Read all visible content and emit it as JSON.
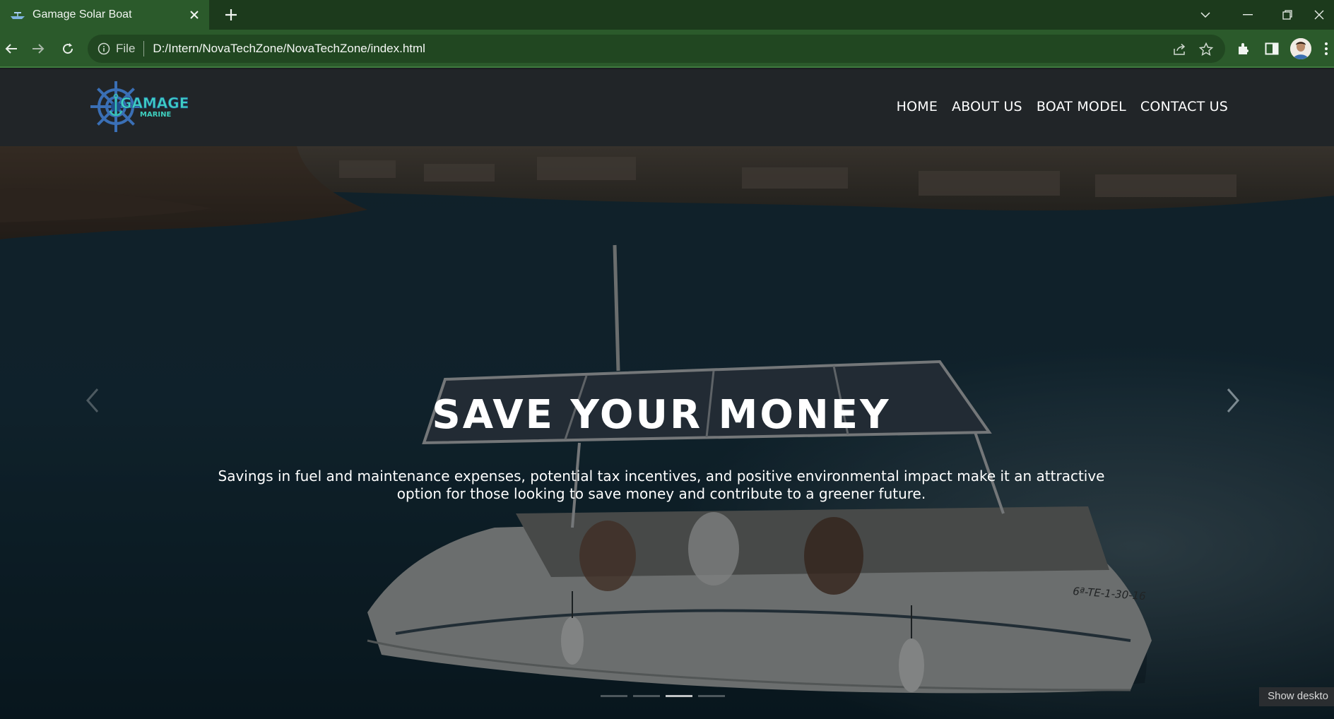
{
  "browser": {
    "tab": {
      "title": "Gamage Solar Boat",
      "close_icon": "close-icon",
      "favicon": "boat-favicon-icon"
    },
    "new_tab_icon": "plus-icon",
    "window_controls": [
      "chevron-down-icon",
      "minimize-icon",
      "restore-icon",
      "close-icon"
    ],
    "address": {
      "scheme_label": "File",
      "url": "D:/Intern/NovaTechZone/NovaTechZone/index.html"
    },
    "toolbar_icons": [
      "back-icon",
      "forward-icon",
      "reload-icon",
      "share-icon",
      "star-icon",
      "extensions-icon",
      "side-panel-icon",
      "avatar",
      "menu-icon"
    ]
  },
  "site": {
    "logo": {
      "main": "GAMAGE",
      "sub": "MARINE"
    },
    "nav": [
      {
        "label": "HOME"
      },
      {
        "label": "ABOUT US"
      },
      {
        "label": "BOAT MODEL"
      },
      {
        "label": "CONTACT US"
      }
    ],
    "hero": {
      "title": "SAVE YOUR MONEY",
      "text_line1": "Savings in fuel and maintenance expenses, potential tax incentives, and positive environmental impact make it an attractive",
      "text_line2": "option for those looking to save money and contribute to a greener future.",
      "boat_registration": "6ª-TE-1-30-16",
      "slides_total": 4,
      "active_slide": 3
    }
  },
  "os": {
    "show_desktop": "Show deskto"
  }
}
